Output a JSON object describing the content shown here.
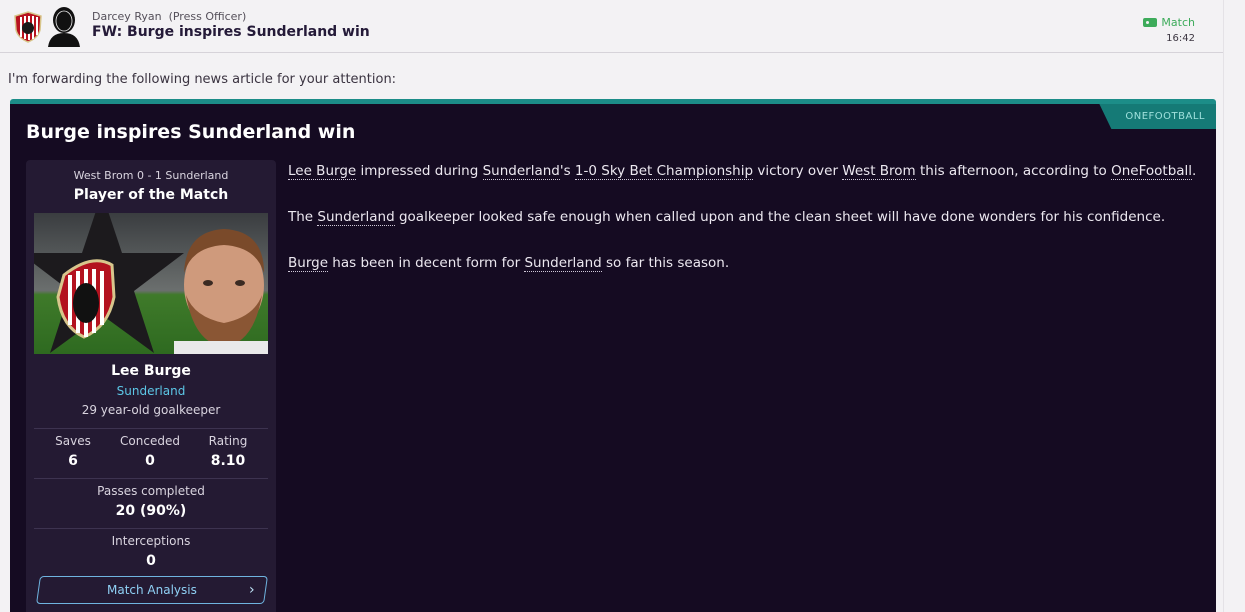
{
  "header": {
    "sender": "Darcey Ryan",
    "sender_role": "(Press Officer)",
    "subject": "FW: Burge inspires Sunderland win",
    "tag": "Match",
    "time": "16:42",
    "icons": [
      "club-badge-icon",
      "sender-avatar-icon",
      "match-tag-icon"
    ]
  },
  "intro": "I'm forwarding the following news article for your attention:",
  "article": {
    "source": "ONEFOOTBALL",
    "headline": "Burge inspires Sunderland win",
    "card": {
      "result": "West Brom 0 - 1 Sunderland",
      "title": "Player of the Match",
      "player_name": "Lee Burge",
      "player_club": "Sunderland",
      "player_desc": "29 year-old goalkeeper",
      "stats": [
        {
          "label": "Saves",
          "value": "6"
        },
        {
          "label": "Conceded",
          "value": "0"
        },
        {
          "label": "Rating",
          "value": "8.10"
        }
      ],
      "passes_label": "Passes completed",
      "passes_value": "20 (90%)",
      "interceptions_label": "Interceptions",
      "interceptions_value": "0",
      "button_label": "Match Analysis"
    },
    "paragraphs": {
      "p1": {
        "player": "Lee Burge",
        "t1": " impressed during ",
        "club": "Sunderland",
        "t2": "'s ",
        "comp": "1-0 Sky Bet Championship",
        "t3": " victory over ",
        "opp": "West Brom",
        "t4": " this afternoon, according to ",
        "source": "OneFootball",
        "t5": "."
      },
      "p2": {
        "t0": "The ",
        "club": "Sunderland",
        "t1": " goalkeeper looked safe enough when called upon and the clean sheet will have done wonders for his confidence."
      },
      "p3": {
        "player": "Burge",
        "t1": " has been in decent form for ",
        "club": "Sunderland",
        "t2": " so far this season."
      }
    }
  },
  "colors": {
    "accent_teal": "#1c8d88",
    "article_bg": "#150b22",
    "card_bg": "#241a33",
    "club_link": "#5cc6e6",
    "tag_green": "#3dab5a"
  }
}
